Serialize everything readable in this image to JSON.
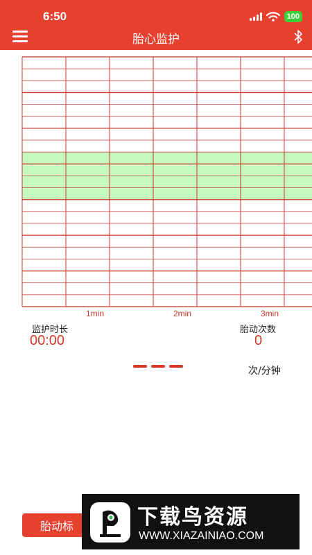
{
  "status_bar": {
    "time": "6:50",
    "battery": "100",
    "icons": [
      "signal-icon",
      "wifi-icon",
      "battery-icon"
    ]
  },
  "header": {
    "title": "胎心监护",
    "left_icon": "menu-icon",
    "right_icon": "bluetooth-icon",
    "color": "#e8402e"
  },
  "chart": {
    "x_tick_labels": [
      "1min",
      "2min",
      "3min"
    ],
    "grid_color": "#c9372c",
    "band_color": "#c6f9c0"
  },
  "stats": {
    "duration_label": "监护时长",
    "duration_value": "00:00",
    "movement_label": "胎动次数",
    "movement_value": "0",
    "unit": "次/分钟",
    "value_color": "#d9372a"
  },
  "buttons": {
    "mark_label": "胎动标"
  },
  "watermark": {
    "title": "下载鸟资源",
    "url": "WWW.XIAZAINIAO.COM"
  }
}
